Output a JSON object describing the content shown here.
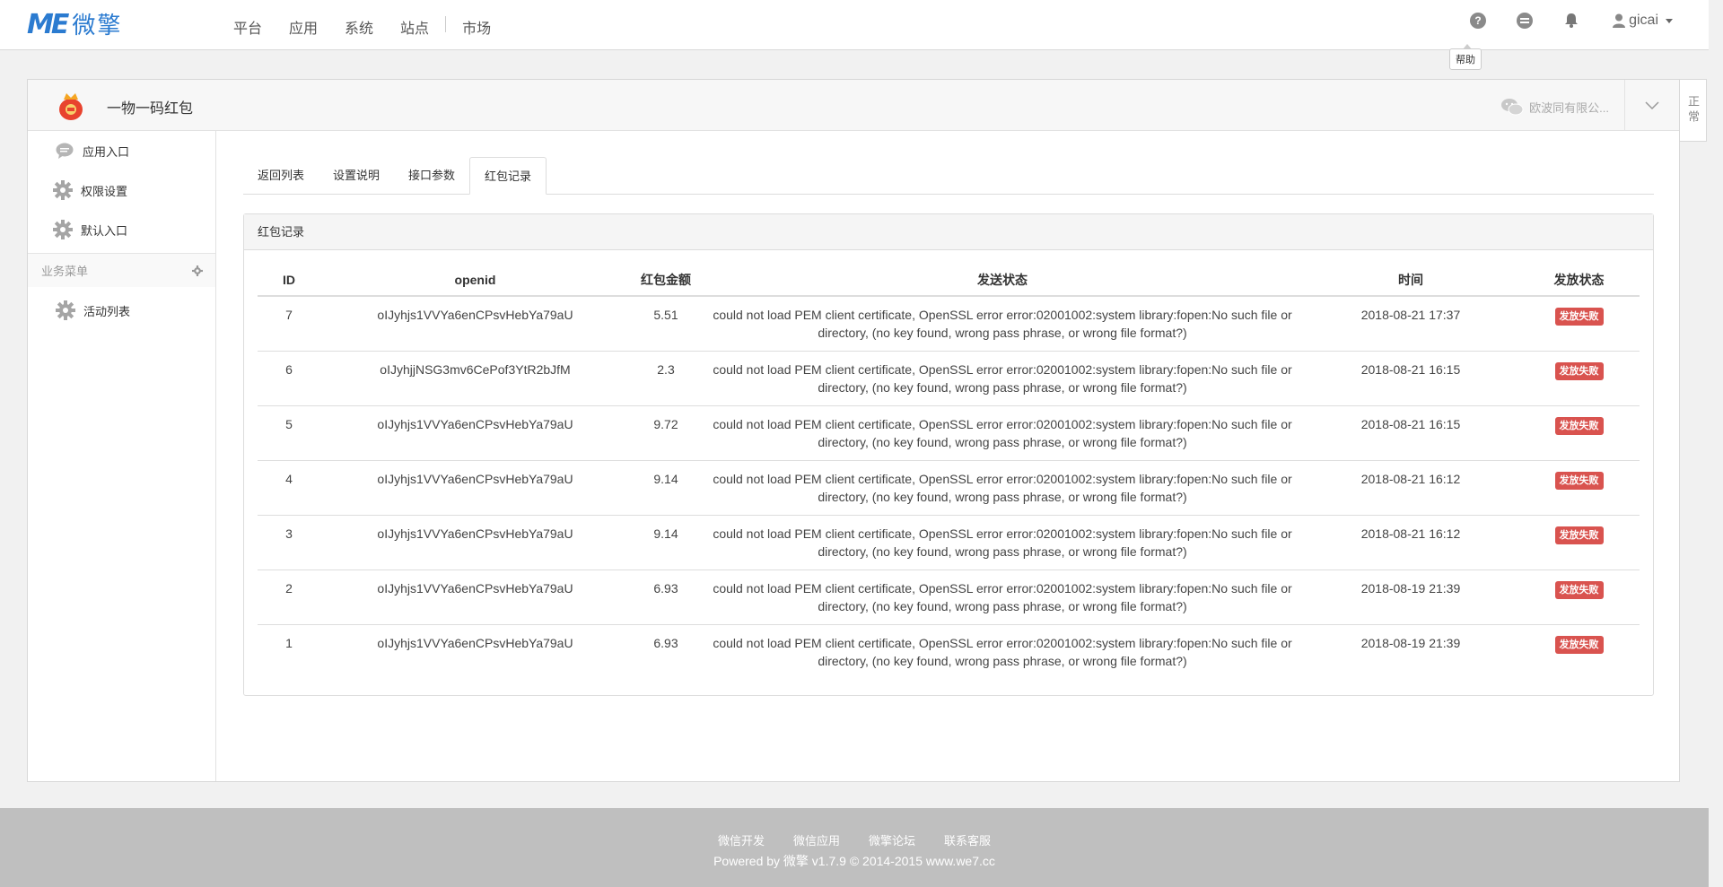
{
  "navbar": {
    "logo_mark": "ME",
    "logo_text": "微擎",
    "menu": [
      "平台",
      "应用",
      "系统",
      "站点",
      "市场"
    ],
    "user": "gicai",
    "tooltip": "帮助"
  },
  "app": {
    "title": "一物一码红包",
    "account": "欧波同有限公...",
    "status_tab": "正常"
  },
  "sidebar": {
    "items": [
      {
        "label": "应用入口",
        "icon": "comment-icon"
      },
      {
        "label": "权限设置",
        "icon": "gear-icon"
      },
      {
        "label": "默认入口",
        "icon": "gear-icon"
      }
    ],
    "section_label": "业务菜单",
    "section_items": [
      {
        "label": "活动列表",
        "icon": "gear-icon"
      }
    ]
  },
  "tabs": [
    "返回列表",
    "设置说明",
    "接口参数",
    "红包记录"
  ],
  "active_tab": 3,
  "panel": {
    "heading": "红包记录",
    "columns": [
      "ID",
      "openid",
      "红包金额",
      "发送状态",
      "时间",
      "发放状态"
    ],
    "rows": [
      {
        "id": "7",
        "openid": "oIJyhjs1VVYa6enCPsvHebYa79aU",
        "amount": "5.51",
        "message": "could not load PEM client certificate, OpenSSL error error:02001002:system library:fopen:No such file or directory, (no key found, wrong pass phrase, or wrong file format?)",
        "time": "2018-08-21 17:37",
        "status": "发放失败"
      },
      {
        "id": "6",
        "openid": "oIJyhjjNSG3mv6CePof3YtR2bJfM",
        "amount": "2.3",
        "message": "could not load PEM client certificate, OpenSSL error error:02001002:system library:fopen:No such file or directory, (no key found, wrong pass phrase, or wrong file format?)",
        "time": "2018-08-21 16:15",
        "status": "发放失败"
      },
      {
        "id": "5",
        "openid": "oIJyhjs1VVYa6enCPsvHebYa79aU",
        "amount": "9.72",
        "message": "could not load PEM client certificate, OpenSSL error error:02001002:system library:fopen:No such file or directory, (no key found, wrong pass phrase, or wrong file format?)",
        "time": "2018-08-21 16:15",
        "status": "发放失败"
      },
      {
        "id": "4",
        "openid": "oIJyhjs1VVYa6enCPsvHebYa79aU",
        "amount": "9.14",
        "message": "could not load PEM client certificate, OpenSSL error error:02001002:system library:fopen:No such file or directory, (no key found, wrong pass phrase, or wrong file format?)",
        "time": "2018-08-21 16:12",
        "status": "发放失败"
      },
      {
        "id": "3",
        "openid": "oIJyhjs1VVYa6enCPsvHebYa79aU",
        "amount": "9.14",
        "message": "could not load PEM client certificate, OpenSSL error error:02001002:system library:fopen:No such file or directory, (no key found, wrong pass phrase, or wrong file format?)",
        "time": "2018-08-21 16:12",
        "status": "发放失败"
      },
      {
        "id": "2",
        "openid": "oIJyhjs1VVYa6enCPsvHebYa79aU",
        "amount": "6.93",
        "message": "could not load PEM client certificate, OpenSSL error error:02001002:system library:fopen:No such file or directory, (no key found, wrong pass phrase, or wrong file format?)",
        "time": "2018-08-19 21:39",
        "status": "发放失败"
      },
      {
        "id": "1",
        "openid": "oIJyhjs1VVYa6enCPsvHebYa79aU",
        "amount": "6.93",
        "message": "could not load PEM client certificate, OpenSSL error error:02001002:system library:fopen:No such file or directory, (no key found, wrong pass phrase, or wrong file format?)",
        "time": "2018-08-19 21:39",
        "status": "发放失败"
      }
    ]
  },
  "footer": {
    "links": [
      "微信开发",
      "微信应用",
      "微擎论坛",
      "联系客服"
    ],
    "copyright": "Powered by 微擎 v1.7.9 © 2014-2015 www.we7.cc"
  },
  "colors": {
    "brand": "#2b7bd0",
    "danger": "#d9534f",
    "footer": "#bfbfbf"
  }
}
